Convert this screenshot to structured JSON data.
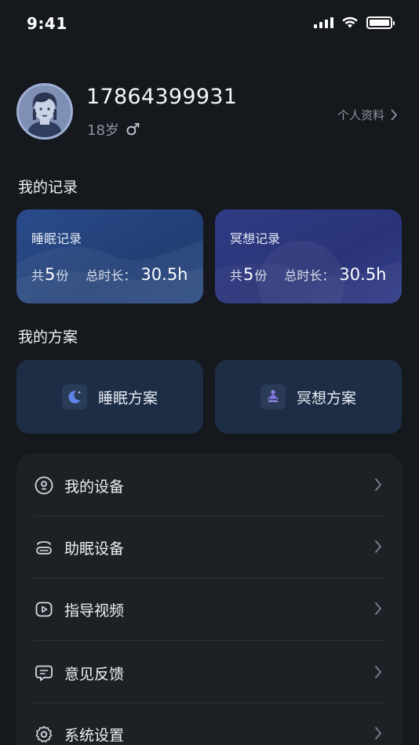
{
  "status_bar": {
    "time": "9:41"
  },
  "profile": {
    "phone": "17864399931",
    "age": "18岁",
    "gender_symbol": "♂",
    "profile_link": "个人资料"
  },
  "records": {
    "title": "我的记录",
    "sleep": {
      "title": "睡眠记录",
      "count_prefix": "共",
      "count": "5",
      "count_suffix": "份",
      "duration_label": "总时长：",
      "duration": "30.5h"
    },
    "meditation": {
      "title": "冥想记录",
      "count_prefix": "共",
      "count": "5",
      "count_suffix": "份",
      "duration_label": "总时长：",
      "duration": "30.5h"
    }
  },
  "plans": {
    "title": "我的方案",
    "sleep_label": "睡眠方案",
    "meditation_label": "冥想方案"
  },
  "menu": {
    "items": [
      {
        "label": "我的设备",
        "icon": "device-icon"
      },
      {
        "label": "助眠设备",
        "icon": "sleep-device-icon"
      },
      {
        "label": "指导视频",
        "icon": "video-icon"
      },
      {
        "label": "意见反馈",
        "icon": "feedback-icon"
      },
      {
        "label": "系统设置",
        "icon": "gear-icon"
      }
    ]
  },
  "colors": {
    "background": "#15181d",
    "sleep_card": "#2a4b8b",
    "meditation_card": "#2e3b84",
    "plan_card": "#1d2d46",
    "menu_panel": "#1d2025"
  }
}
